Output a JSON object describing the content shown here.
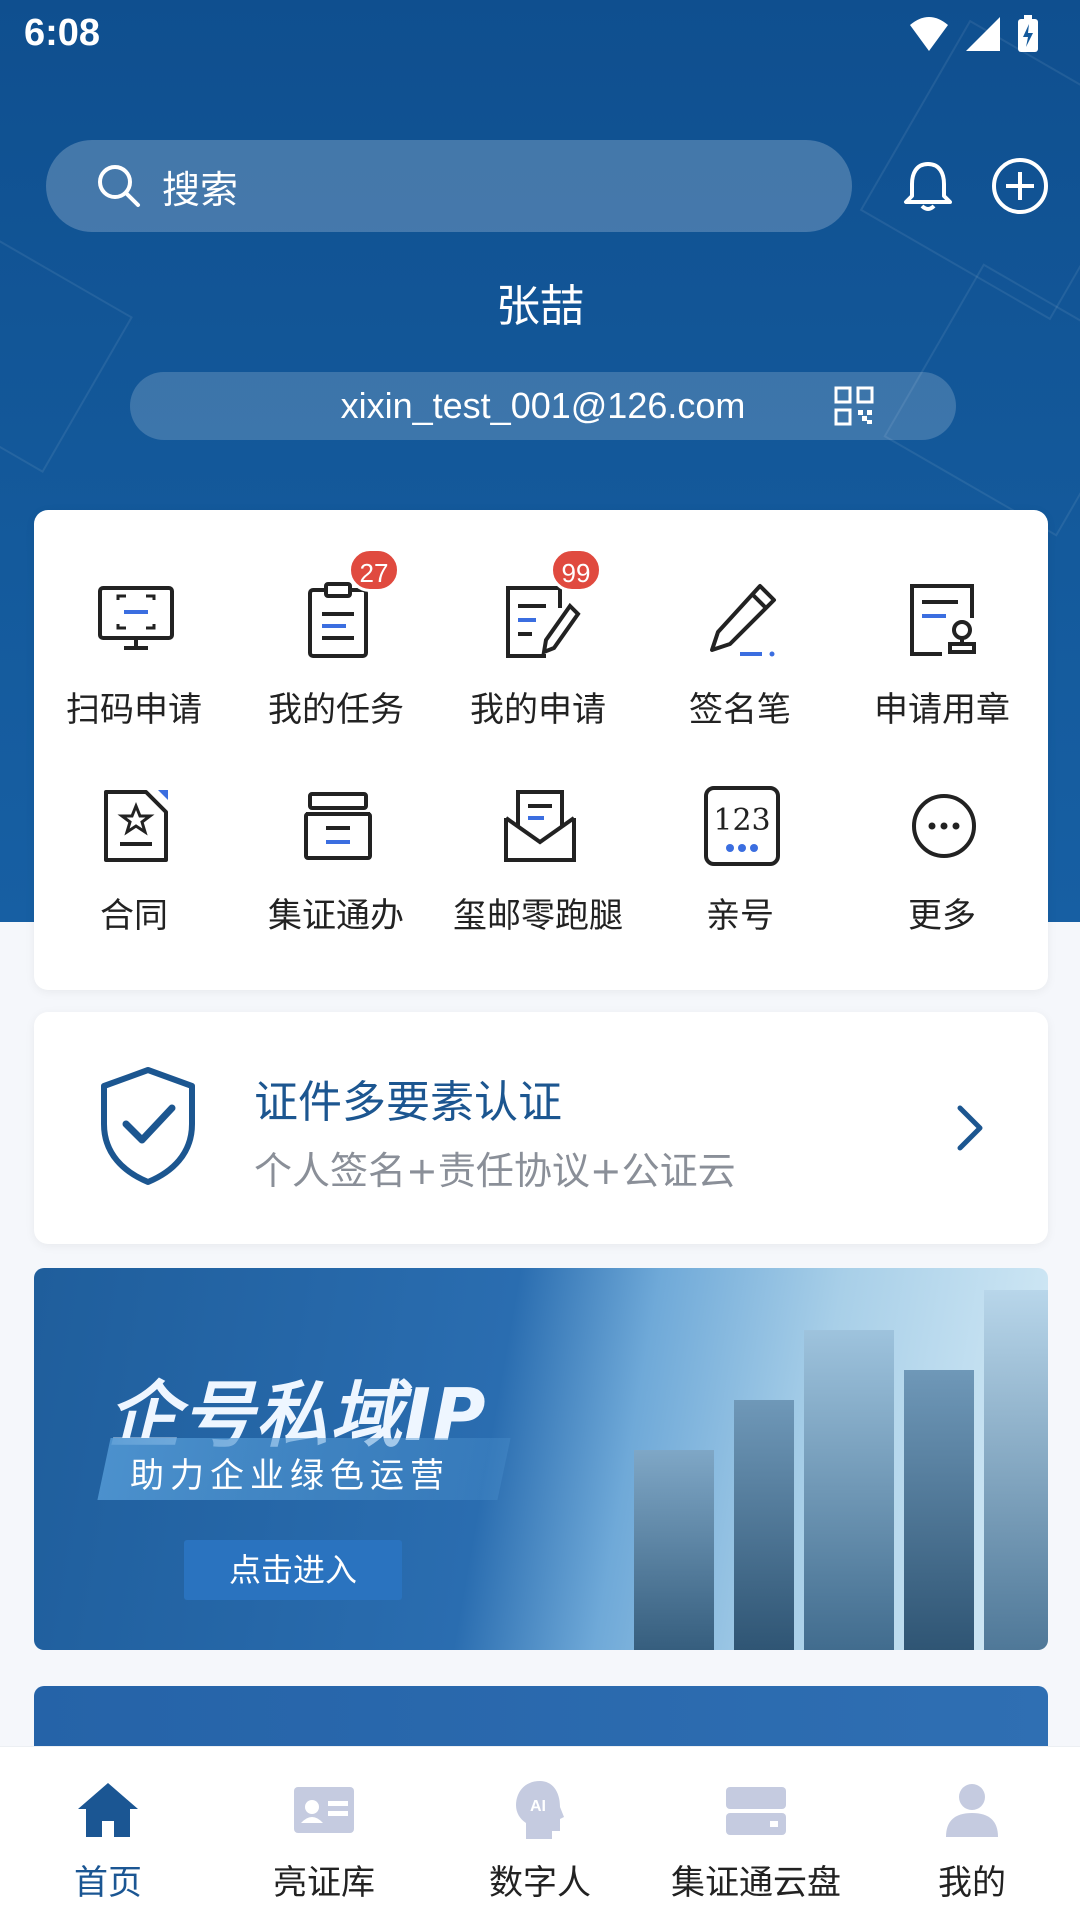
{
  "status_bar": {
    "time": "6:08"
  },
  "search": {
    "placeholder": "搜索"
  },
  "user": {
    "name": "张喆",
    "email": "xixin_test_001@126.com"
  },
  "services": [
    {
      "label": "扫码申请",
      "icon": "scan-screen-icon"
    },
    {
      "label": "我的任务",
      "icon": "clipboard-icon",
      "badge": "27"
    },
    {
      "label": "我的申请",
      "icon": "document-edit-icon",
      "badge": "99"
    },
    {
      "label": "签名笔",
      "icon": "pen-icon"
    },
    {
      "label": "申请用章",
      "icon": "seal-document-icon"
    },
    {
      "label": "合同",
      "icon": "contract-icon"
    },
    {
      "label": "集证通办",
      "icon": "archive-box-icon"
    },
    {
      "label": "玺邮零跑腿",
      "icon": "mail-envelope-icon"
    },
    {
      "label": "亲号",
      "icon": "number-123-icon"
    },
    {
      "label": "更多",
      "icon": "more-dots-icon"
    }
  ],
  "auth_card": {
    "title": "证件多要素认证",
    "subtitle": "个人签名+责任协议+公证云"
  },
  "banner": {
    "title": "企号私域IP",
    "subtitle": "助力企业绿色运营",
    "button": "点击进入"
  },
  "tabs": [
    {
      "label": "首页",
      "icon": "home-icon",
      "active": true
    },
    {
      "label": "亮证库",
      "icon": "id-card-icon"
    },
    {
      "label": "数字人",
      "icon": "ai-head-icon"
    },
    {
      "label": "集证通云盘",
      "icon": "cloud-drive-icon"
    },
    {
      "label": "我的",
      "icon": "user-icon"
    }
  ],
  "colors": {
    "primary": "#145a9c",
    "badge": "#e04a3f",
    "accent_text": "#1c5690"
  }
}
